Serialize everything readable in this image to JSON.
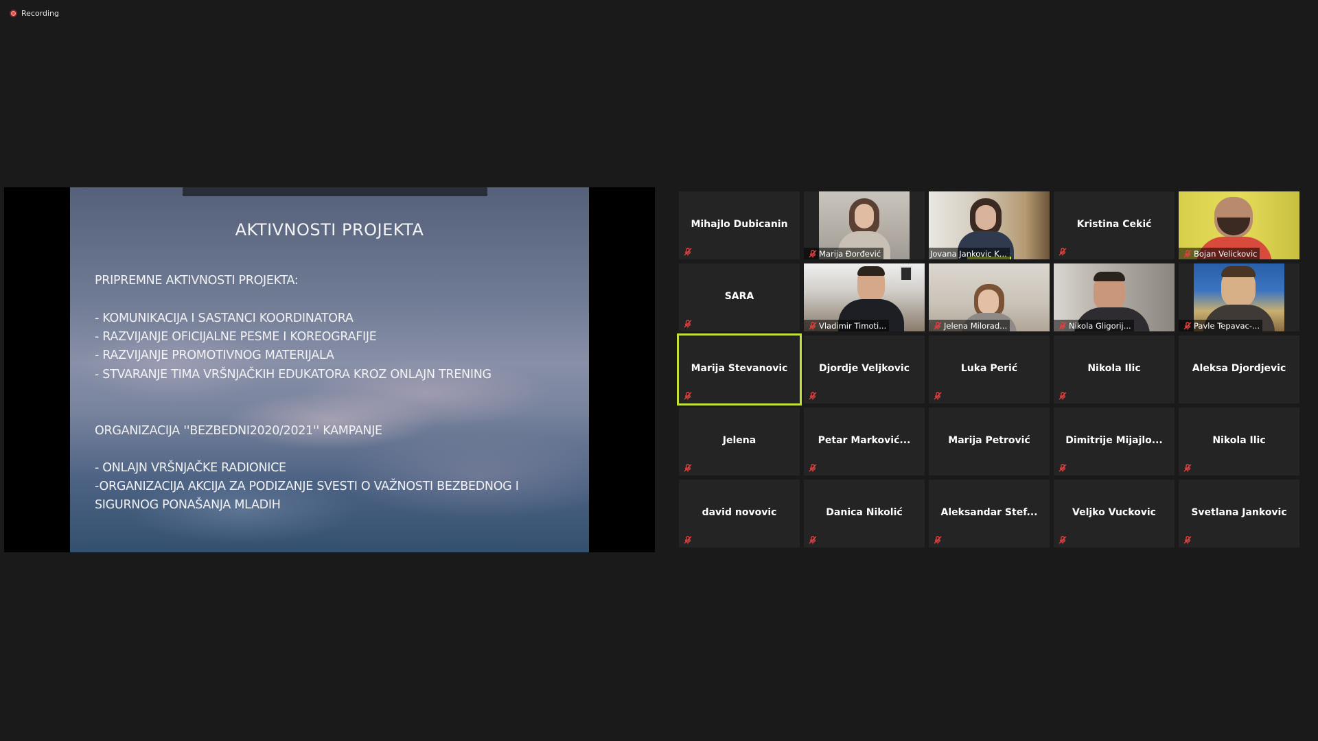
{
  "recording": {
    "label": "Recording"
  },
  "slide": {
    "title": "AKTIVNOSTI PROJEKTA",
    "lines": [
      "PRIPREMNE AKTIVNOSTI PROJEKTA:",
      "- KOMUNIKACIJA I SASTANCI KOORDINATORA",
      "- RAZVIJANJE OFICIJALNE PESME I KOREOGRAFIJE",
      "- RAZVIJANJE PROMOTIVNOG MATERIJALA",
      "- STVARANJE TIMA VRŠNJAČKIH EDUKATORA KROZ ONLAJN TRENING",
      "ORGANIZACIJA ''BEZBEDNI2020/2021'' KAMPANJE",
      "- ONLAJN VRŠNJAČKE RADIONICE",
      "-ORGANIZACIJA AKCIJA ZA PODIZANJE SVESTI O VAŽNOSTI BEZBEDNOG I",
      "SIGURNOG PONAŠANJA MLADIH"
    ]
  },
  "participants": [
    {
      "name": "Mihajlo Dubicanin",
      "video": false
    },
    {
      "name": "Marija Đorđević",
      "video": true
    },
    {
      "name": "Jovana Jankovic K...",
      "video": true
    },
    {
      "name": "Kristina Cekić",
      "video": false
    },
    {
      "name": "Bojan Velickovic",
      "video": true
    },
    {
      "name": "SARA",
      "video": false
    },
    {
      "name": "Vladimir Timoti...",
      "video": true
    },
    {
      "name": "Jelena Milorad...",
      "video": true
    },
    {
      "name": "Nikola Gligorij...",
      "video": true
    },
    {
      "name": "Pavle Tepavac-...",
      "video": true
    },
    {
      "name": "Marija Stevanovic",
      "video": false
    },
    {
      "name": "Djordje Veljkovic",
      "video": false
    },
    {
      "name": "Luka Perić",
      "video": false
    },
    {
      "name": "Nikola Ilic",
      "video": false
    },
    {
      "name": "Aleksa Djordjevic",
      "video": false
    },
    {
      "name": "Jelena",
      "video": false
    },
    {
      "name": "Petar  Marković...",
      "video": false
    },
    {
      "name": "Marija Petrović",
      "video": false
    },
    {
      "name": "Dimitrije  Mijajlo...",
      "video": false
    },
    {
      "name": "Nikola Ilic",
      "video": false
    },
    {
      "name": "david novovic",
      "video": false
    },
    {
      "name": "Danica Nikolić",
      "video": false
    },
    {
      "name": "Aleksandar  Stef...",
      "video": false
    },
    {
      "name": "Veljko Vuckovic",
      "video": false
    },
    {
      "name": "Svetlana Jankovic",
      "video": false
    }
  ],
  "colors": {
    "background": "#1a1a1a",
    "tile": "#242424",
    "active_speaker": "#c3e13c",
    "mute_icon": "#e0413e"
  },
  "icons": {
    "mute": "microphone-muted-icon",
    "recording": "recording-dot-icon"
  }
}
